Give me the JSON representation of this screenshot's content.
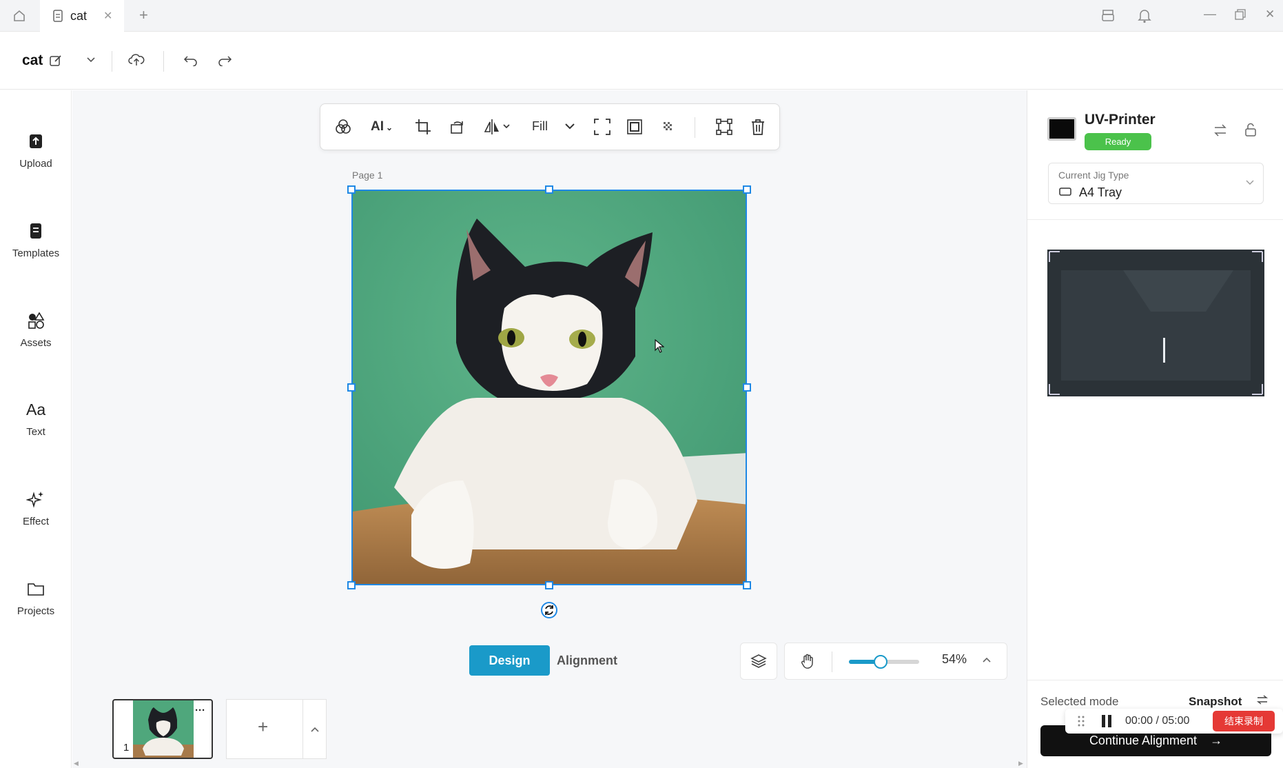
{
  "titlebar": {
    "tab_label": "cat",
    "new_tab": "+"
  },
  "toolbar": {
    "doc_title": "cat"
  },
  "sidebar": {
    "items": [
      {
        "label": "Upload",
        "icon": "upload-icon"
      },
      {
        "label": "Templates",
        "icon": "templates-icon"
      },
      {
        "label": "Assets",
        "icon": "assets-icon"
      },
      {
        "label": "Text",
        "icon": "text-icon",
        "glyph": "Aa"
      },
      {
        "label": "Effect",
        "icon": "sparkle-icon"
      },
      {
        "label": "Projects",
        "icon": "folder-icon"
      }
    ]
  },
  "canvas_toolbar": {
    "ai_label": "AI",
    "fill_label": "Fill"
  },
  "canvas": {
    "page_label": "Page 1"
  },
  "mode_switch": {
    "design": "Design",
    "alignment": "Alignment"
  },
  "zoom": {
    "percent_label": "54%",
    "level": 0.54
  },
  "pages": {
    "thumb_number": "1",
    "thumb_menu": "···",
    "add": "+"
  },
  "printer": {
    "name": "UV-Printer",
    "status": "Ready",
    "jig_label": "Current Jig Type",
    "jig_value": "A4 Tray"
  },
  "footer": {
    "selected_mode_label": "Selected mode",
    "snapshot_label": "Snapshot",
    "continue_label": "Continue Alignment"
  },
  "recorder": {
    "time": "00:00 / 05:00",
    "stop_label": "结束录制"
  },
  "colors": {
    "accent": "#1a9ac9",
    "selection": "#1e88e5",
    "ready": "#4bc24b",
    "record_stop": "#e53935"
  }
}
